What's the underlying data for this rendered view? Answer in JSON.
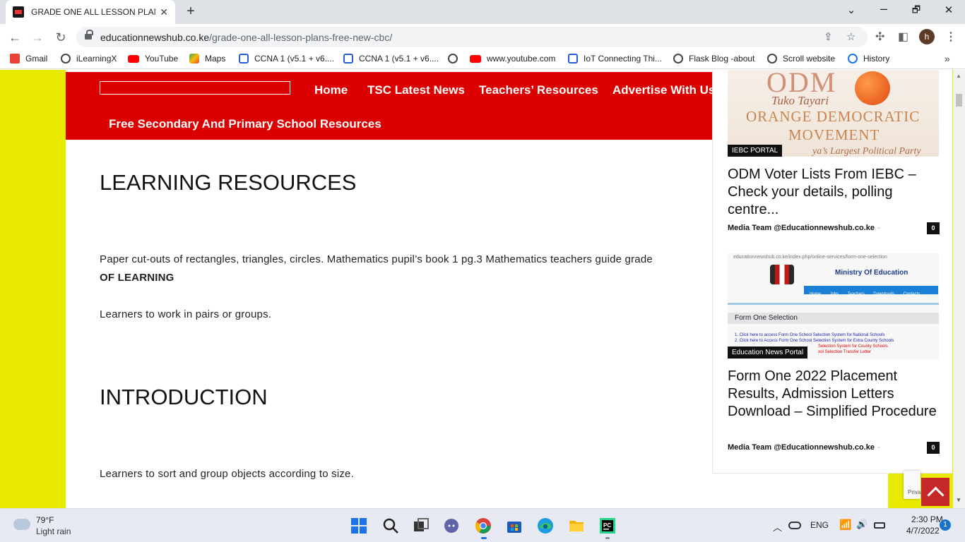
{
  "browser": {
    "tab_title": "GRADE ONE ALL LESSON PLANS",
    "tab_close": "✕",
    "new_tab": "+",
    "url_domain": "educationnewshub.co.ke",
    "url_path": "/grade-one-all-lesson-plans-free-new-cbc/",
    "avatar_letter": "h",
    "win_minimize": "⌄",
    "win_restore": "🗗",
    "win_close": "✕"
  },
  "bookmarks": [
    {
      "label": "Gmail",
      "icon": "gmail-icon",
      "color": "#ea4335"
    },
    {
      "label": "iLearningX",
      "icon": "globe-icon",
      "color": "#444444"
    },
    {
      "label": "YouTube",
      "icon": "youtube-icon",
      "color": "#ff0000"
    },
    {
      "label": "Maps",
      "icon": "maps-icon",
      "color": "#34a853"
    },
    {
      "label": "CCNA 1 (v5.1 + v6....",
      "icon": "ccna-icon",
      "color": "#2a5bd7"
    },
    {
      "label": "CCNA 1 (v5.1 + v6....",
      "icon": "ccna-icon",
      "color": "#2a5bd7"
    },
    {
      "label": "",
      "icon": "globe-icon",
      "color": "#444444"
    },
    {
      "label": "www.youtube.com",
      "icon": "youtube-icon",
      "color": "#ff0000"
    },
    {
      "label": "IoT Connecting Thi...",
      "icon": "ccna-icon",
      "color": "#2a5bd7"
    },
    {
      "label": "Flask Blog -about",
      "icon": "globe-icon",
      "color": "#444444"
    },
    {
      "label": "Scroll website",
      "icon": "globe-icon",
      "color": "#444444"
    },
    {
      "label": "History",
      "icon": "history-icon",
      "color": "#1a73e8"
    }
  ],
  "site": {
    "nav": [
      "Home",
      "TSC Latest News",
      "Teachers’ Resources",
      "Advertise With Us"
    ],
    "nav_sub": "Free Secondary And Primary School Resources"
  },
  "content": {
    "heading1": "LEARNING RESOURCES",
    "para1": "Paper cut-outs of rectangles, triangles, circles. Mathematics pupil’s book 1 pg.3 Mathematics teachers guide grade",
    "para1_bold": "OF LEARNING",
    "para2": "Learners to work in pairs or groups.",
    "heading2": "INTRODUCTION",
    "para3": "Learners to sort and group objects according to size."
  },
  "sidebar": {
    "post1": {
      "image_text": {
        "big": "ODM",
        "tuko": "Tuko Tayari",
        "line1": "ORANGE DEMOCRATIC",
        "line2": "MOVEMENT",
        "tag": "ya’s Largest Political Party"
      },
      "category": "IEBC PORTAL",
      "title": "ODM Voter Lists From IEBC – Check your details, polling centre...",
      "author": "Media Team @Educationnewshub.co.ke",
      "author_sep": "-",
      "comments": "0"
    },
    "post2": {
      "image_text": {
        "url": "educationnewshub.co.ke/index.php/online-services/form-one-selection",
        "title": "Ministry Of Education",
        "menu": [
          "Home",
          "Jobs",
          "Teachers",
          "Downloads",
          "Contacts"
        ],
        "bar": "Form One Selection",
        "link1": "1. Click here to access Form One School Selection System for National Schools",
        "link2": "2. Click here to Access Form One School Selection System for Extra County Schools",
        "link3": "Selection System for County Schools",
        "link4": "ool Selection Transfer Letter"
      },
      "category": "Education News Portal",
      "title": "Form One 2022 Placement Results, Admission Letters Download – Simplified Procedure",
      "author": "Media Team @Educationnewshub.co.ke",
      "author_sep": "-",
      "comments": "0"
    },
    "recaptcha": "Priva"
  },
  "taskbar": {
    "weather_temp": "79°F",
    "weather_desc": "Light rain",
    "lang": "ENG",
    "time": "2:30 PM",
    "date": "4/7/2022",
    "notifications": "1"
  }
}
